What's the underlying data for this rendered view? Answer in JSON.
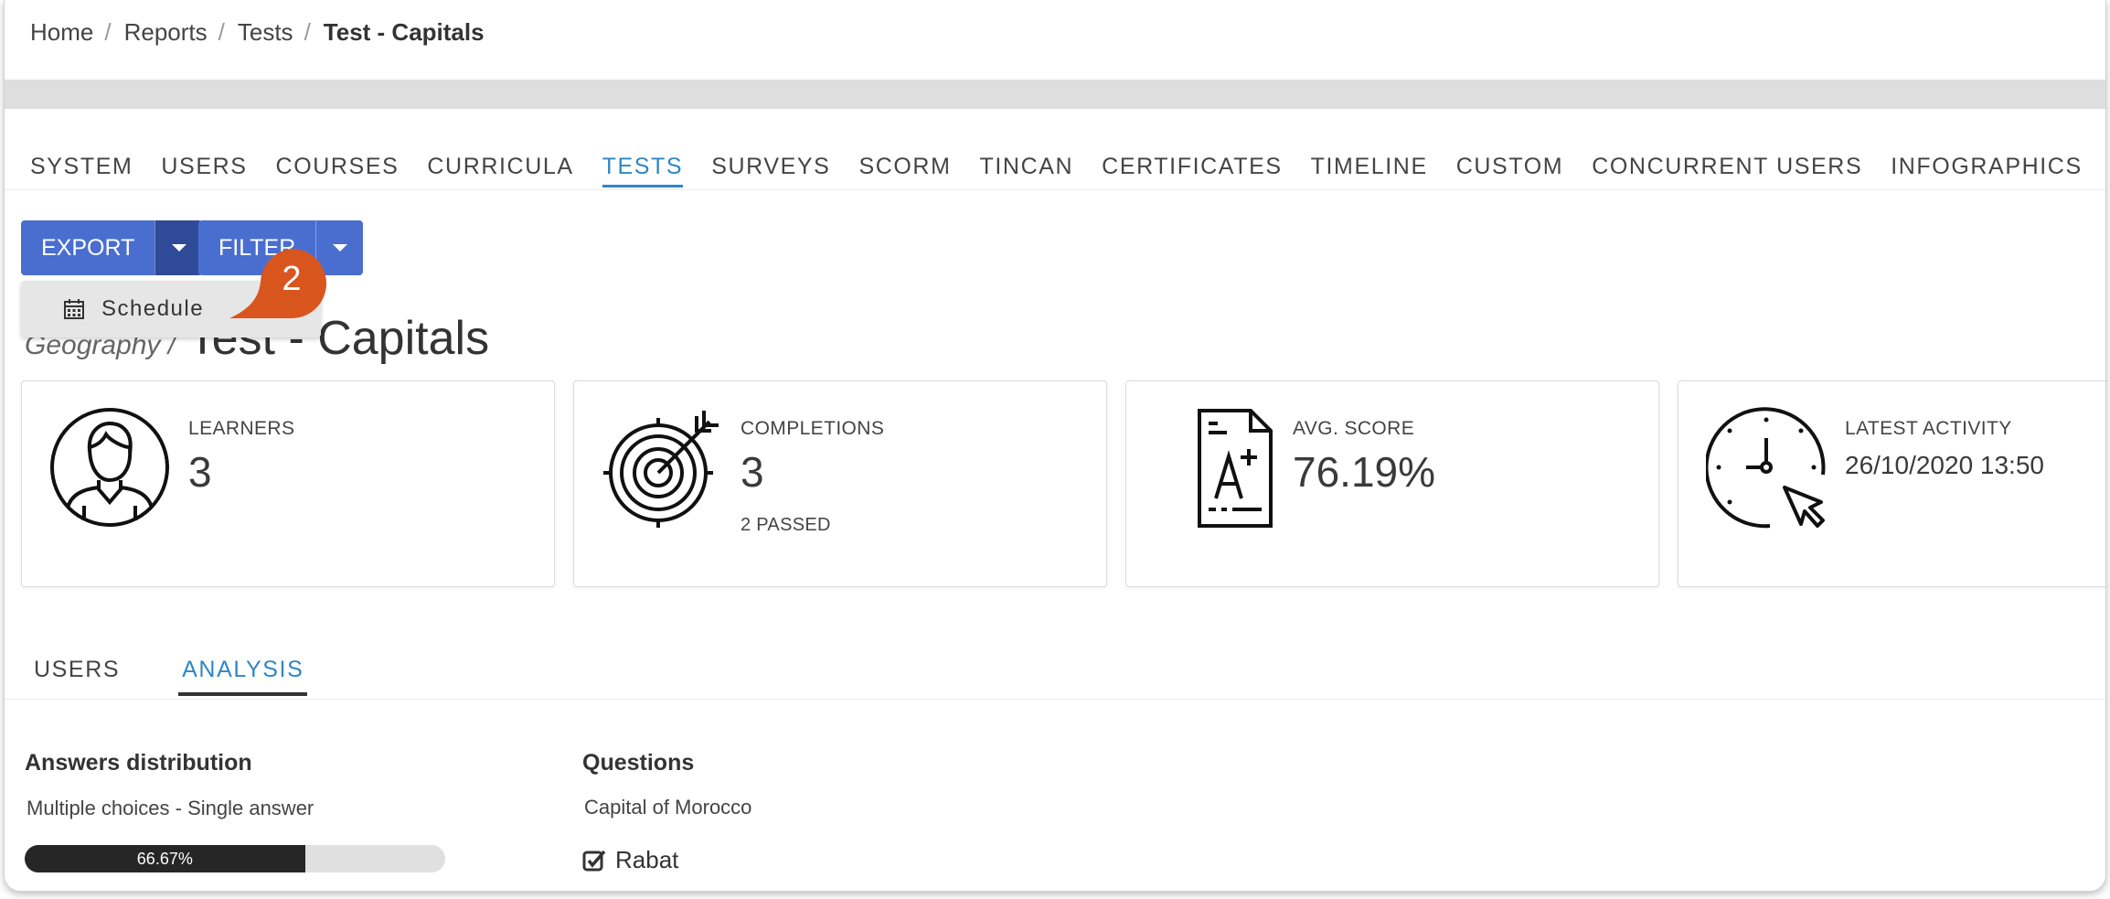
{
  "breadcrumb": {
    "home": "Home",
    "reports": "Reports",
    "tests": "Tests",
    "current": "Test - Capitals",
    "sep": "/"
  },
  "main_tabs": [
    "SYSTEM",
    "USERS",
    "COURSES",
    "CURRICULA",
    "TESTS",
    "SURVEYS",
    "SCORM",
    "TINCAN",
    "CERTIFICATES",
    "TIMELINE",
    "CUSTOM",
    "CONCURRENT USERS",
    "INFOGRAPHICS"
  ],
  "active_tab": "TESTS",
  "toolbar": {
    "export_label": "EXPORT",
    "filter_label": "FILTER"
  },
  "dropdown": {
    "schedule_label": "Schedule"
  },
  "step_badge": "2",
  "heading": {
    "category": "Geography /",
    "title": "Test - Capitals"
  },
  "stats": {
    "learners": {
      "label": "LEARNERS",
      "value": "3"
    },
    "completions": {
      "label": "COMPLETIONS",
      "value": "3",
      "sub": "2 PASSED"
    },
    "avg_score": {
      "label": "AVG. SCORE",
      "value": "76.19%"
    },
    "latest_activity": {
      "label": "LATEST ACTIVITY",
      "value": "26/10/2020 13:50"
    }
  },
  "sub_tabs": {
    "users": "USERS",
    "analysis": "ANALYSIS"
  },
  "analysis": {
    "distribution_title": "Answers distribution",
    "question_type": "Multiple choices - Single answer",
    "progress_value": 66.67,
    "progress_label": "66.67%",
    "questions_title": "Questions",
    "question": "Capital of Morocco",
    "answer": "Rabat"
  },
  "colors": {
    "accent": "#2f86c5",
    "button": "#4a6ed0",
    "button_dark": "#2f4a98",
    "badge": "#d9561f"
  }
}
